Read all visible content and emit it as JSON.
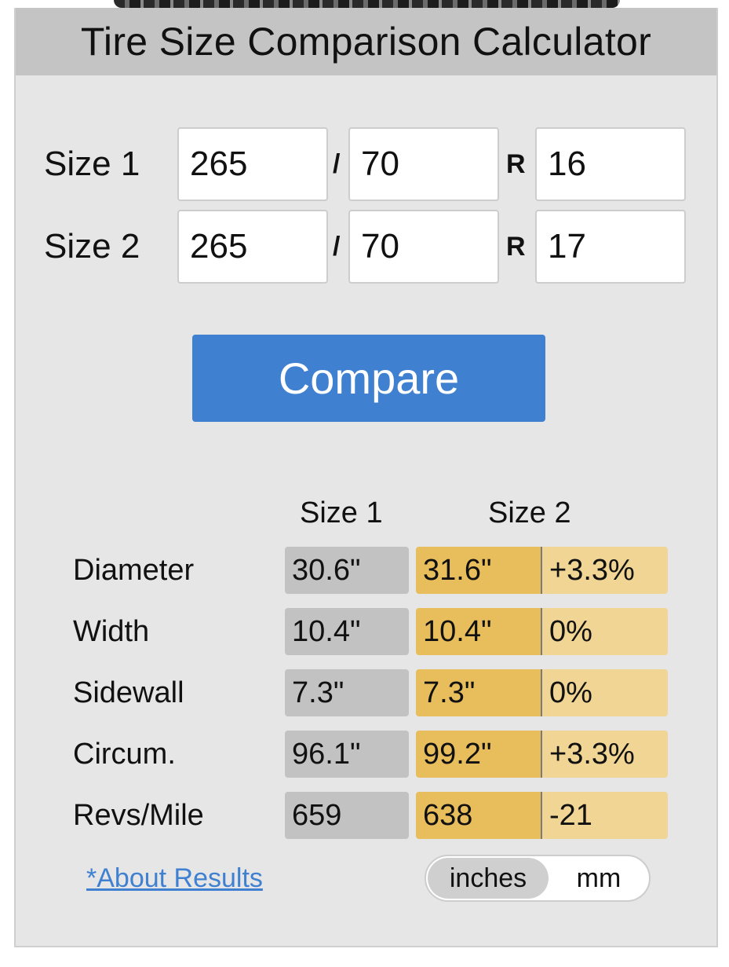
{
  "title": "Tire Size Comparison Calculator",
  "sizes": [
    {
      "label": "Size 1",
      "width": "265",
      "aspect": "70",
      "rim": "16"
    },
    {
      "label": "Size 2",
      "width": "265",
      "aspect": "70",
      "rim": "17"
    }
  ],
  "separators": {
    "slash": "/",
    "r": "R"
  },
  "compare_label": "Compare",
  "columns": {
    "size1": "Size 1",
    "size2": "Size 2"
  },
  "results": [
    {
      "label": "Diameter",
      "size1": "30.6\"",
      "size2": "31.6\"",
      "diff": "+3.3%"
    },
    {
      "label": "Width",
      "size1": "10.4\"",
      "size2": "10.4\"",
      "diff": "0%"
    },
    {
      "label": "Sidewall",
      "size1": "7.3\"",
      "size2": "7.3\"",
      "diff": "0%"
    },
    {
      "label": "Circum.",
      "size1": "96.1\"",
      "size2": "99.2\"",
      "diff": "+3.3%"
    },
    {
      "label": "Revs/Mile",
      "size1": "659",
      "size2": "638",
      "diff": "-21"
    }
  ],
  "about_link": "*About Results",
  "units": {
    "inches": "inches",
    "mm": "mm",
    "selected": "inches"
  },
  "colors": {
    "accent": "#3f80d1",
    "size1_cell": "#c2c2c2",
    "size2_cell": "#e8bd5c",
    "diff_cell": "#f0d594",
    "panel": "#e6e6e6",
    "title_bar": "#c4c4c4"
  }
}
